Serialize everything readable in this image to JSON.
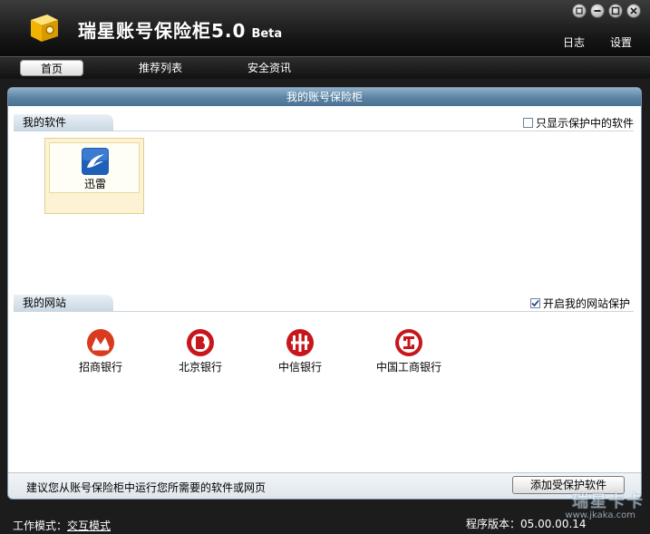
{
  "app": {
    "title": "瑞星账号保险柜5.0",
    "beta": "Beta",
    "links": [
      "日志",
      "设置"
    ]
  },
  "tabs": [
    {
      "label": "首页",
      "active": true
    },
    {
      "label": "推荐列表",
      "active": false
    },
    {
      "label": "安全资讯",
      "active": false
    }
  ],
  "panel": {
    "title": "我的账号保险柜",
    "software": {
      "header": "我的软件",
      "filter_label": "只显示保护中的软件",
      "filter_checked": false,
      "items": [
        {
          "name": "迅雷",
          "icon": "xunlei-icon"
        }
      ]
    },
    "websites": {
      "header": "我的网站",
      "protect_label": "开启我的网站保护",
      "protect_checked": true,
      "items": [
        {
          "name": "招商银行",
          "icon": "cmb-icon",
          "color": "#d93b1f"
        },
        {
          "name": "北京银行",
          "icon": "bob-icon",
          "color": "#c8161d"
        },
        {
          "name": "中信银行",
          "icon": "citic-icon",
          "color": "#c8161d"
        },
        {
          "name": "中国工商银行",
          "icon": "icbc-icon",
          "color": "#c8161d"
        }
      ]
    },
    "status_text": "建议您从账号保险柜中运行您所需要的软件或网页",
    "add_button": "添加受保护软件"
  },
  "footer": {
    "mode_label": "工作模式：",
    "mode_value": "交互模式",
    "version_label": "程序版本：",
    "version_value": "05.00.00.14",
    "watermark": "瑞星卡卡",
    "watermark_url": "www.jkaka.com"
  }
}
